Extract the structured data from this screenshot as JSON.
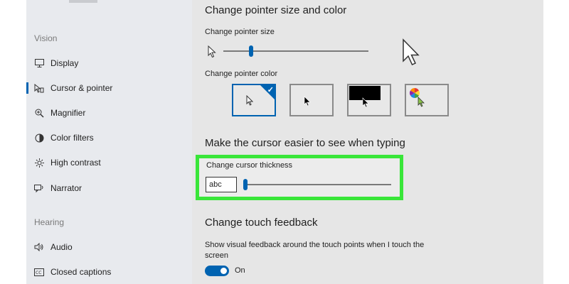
{
  "sidebar": {
    "section_vision": "Vision",
    "section_hearing": "Hearing",
    "items": [
      {
        "label": "Display",
        "icon": "display-icon"
      },
      {
        "label": "Cursor & pointer",
        "icon": "cursor-pointer-icon"
      },
      {
        "label": "Magnifier",
        "icon": "magnifier-icon"
      },
      {
        "label": "Color filters",
        "icon": "color-filters-icon"
      },
      {
        "label": "High contrast",
        "icon": "high-contrast-icon"
      },
      {
        "label": "Narrator",
        "icon": "narrator-icon"
      },
      {
        "label": "Audio",
        "icon": "audio-icon"
      },
      {
        "label": "Closed captions",
        "icon": "closed-captions-icon"
      }
    ]
  },
  "main": {
    "pointer_heading": "Change pointer size and color",
    "pointer_size_label": "Change pointer size",
    "pointer_color_label": "Change pointer color",
    "cursor_heading": "Make the cursor easier to see when typing",
    "cursor_thickness_label": "Change cursor thickness",
    "cursor_preview_text": "abc",
    "touch_heading": "Change touch feedback",
    "touch_description": "Show visual feedback around the touch points when I touch the screen",
    "touch_toggle_state": "On"
  },
  "colors": {
    "accent": "#0063b1",
    "highlight": "#39e639"
  }
}
